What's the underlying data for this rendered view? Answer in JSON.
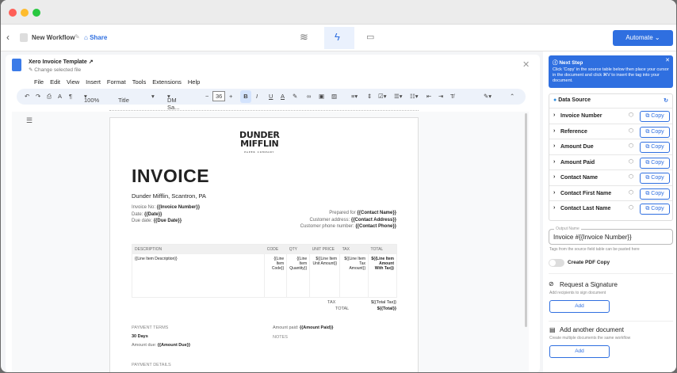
{
  "header": {
    "workflow_name": "New Workflow",
    "share_label": "Share",
    "automate_label": "Automate"
  },
  "doc": {
    "file_title": "Xero Invoice Template",
    "change_file": "Change selected file",
    "menu": [
      "File",
      "Edit",
      "View",
      "Insert",
      "Format",
      "Tools",
      "Extensions",
      "Help"
    ],
    "toolbar": {
      "zoom": "100%",
      "style": "Title",
      "font": "DM Sa...",
      "size": "36"
    }
  },
  "invoice": {
    "logo_line1": "DUNDER",
    "logo_line2": "MIFFLIN",
    "logo_sub": "PAPER COMPANY",
    "title": "INVOICE",
    "company": "Dunder Mifflin, Scantron, PA",
    "left": [
      [
        "Invoice No: ",
        "{{Invoice Number}}"
      ],
      [
        "Date: ",
        "{{Date}}"
      ],
      [
        "Due date: ",
        "{{Due Date}}"
      ]
    ],
    "right": [
      [
        "Prepared for ",
        "{{Contact Name}}"
      ],
      [
        "Customer address: ",
        "{{Contact Address}}"
      ],
      [
        "Customer phone number: ",
        "{{Contact Phone}}"
      ]
    ],
    "table_headers": [
      "DESCRIPTION",
      "CODE",
      "QTY",
      "UNIT PRICE",
      "TAX",
      "TOTAL"
    ],
    "table_row": [
      "{{Line Item Description}}",
      "{{Line Item Code}}",
      "{{Line Item Quantity}}",
      "${{Line Item Unit Amount}}",
      "${{Line Item Tax Amount}}",
      "${{Line Item Amount With Tax}}"
    ],
    "tax_label": "TAX",
    "tax_value": "${{Total Tax}}",
    "total_label": "TOTAL",
    "total_value": "${{Total}}",
    "payment_terms_label": "PAYMENT TERMS",
    "payment_terms": "30 Days",
    "amount_due_label": "Amount due: ",
    "amount_due": "{{Amount Due}}",
    "amount_paid_label": "Amount paid: ",
    "amount_paid": "{{Amount Paid}}",
    "notes_label": "NOTES",
    "payment_details_label": "PAYMENT DETAILS"
  },
  "next_step": {
    "title": "Next Step",
    "text": "Click 'Copy' in the source table below then place your cursor in the document and click ⌘V to insert the tag into your document."
  },
  "data_source": {
    "title": "Data Source",
    "copy_label": "Copy",
    "fields": [
      "Invoice Number",
      "Reference",
      "Amount Due",
      "Amount Paid",
      "Contact Name",
      "Contact First Name",
      "Contact Last Name"
    ]
  },
  "output": {
    "label": "Output Name",
    "value": "Invoice #{{Invoice Number}}",
    "help": "Tags from the source field table can be pasted here"
  },
  "pdf_toggle": {
    "label": "Create PDF Copy",
    "on": false
  },
  "signature": {
    "title": "Request a Signature",
    "desc": "Add recipients to sign document",
    "button": "Add"
  },
  "another_doc": {
    "title": "Add another document",
    "desc": "Create multiple documents the same workflow",
    "button": "Add"
  },
  "colors": {
    "accent": "#2f6fe0"
  }
}
